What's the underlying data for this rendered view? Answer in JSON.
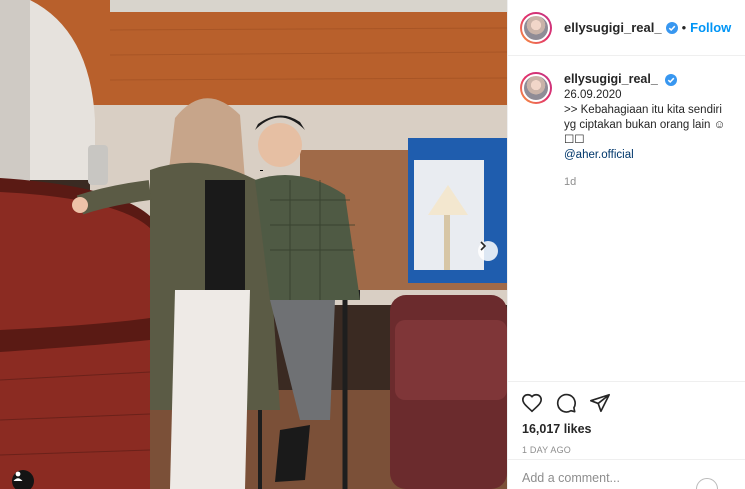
{
  "post": {
    "author": "ellysugigi_real_",
    "follow_label": "Follow",
    "separator": "•",
    "caption": {
      "username": "ellysugigi_real_",
      "date": "26.09.2020",
      "text": ">> Kebahagiaan itu kita sendiri yg ciptakan bukan orang lain ☺︎☐☐",
      "mention": "@aher.official",
      "time": "1d"
    },
    "likes": "16,017 likes",
    "posted_ago": "1 DAY AGO",
    "comment_placeholder": "Add a comment..."
  },
  "colors": {
    "follow_blue": "#0095f6",
    "verified_blue": "#3897f0",
    "mention": "#00376b",
    "muted": "#8e8e8e"
  },
  "icons": {
    "verified": "verified-badge-icon",
    "like": "heart-icon",
    "comment": "comment-icon",
    "share": "paper-plane-icon",
    "next": "chevron-right-icon",
    "tag": "person-tag-icon",
    "emoji": "emoji-icon"
  }
}
